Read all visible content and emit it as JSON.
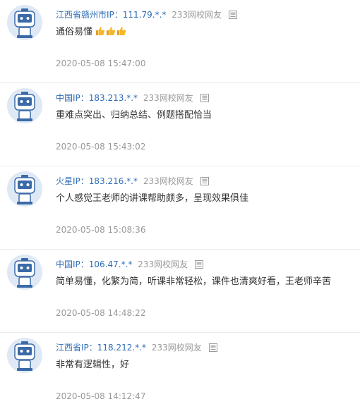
{
  "comments": [
    {
      "location": "江西省赣州市",
      "ip": "IP：111.79.*.*",
      "role": "233网校网友",
      "content": "通俗易懂",
      "emoji": [
        "thumbs-up",
        "thumbs-up",
        "thumbs-up"
      ],
      "time": "2020-05-08 15:47:00"
    },
    {
      "location": "中国",
      "ip": "IP：183.213.*.*",
      "role": "233网校网友",
      "content": "重难点突出、归纳总结、例题搭配恰当",
      "emoji": [],
      "time": "2020-05-08 15:43:02"
    },
    {
      "location": "火星",
      "ip": "IP：183.216.*.*",
      "role": "233网校网友",
      "content": "个人感觉王老师的讲课帮助颇多，呈现效果俱佳",
      "emoji": [],
      "time": "2020-05-08 15:08:36"
    },
    {
      "location": "中国",
      "ip": "IP：106.47.*.*",
      "role": "233网校网友",
      "content": "简单易懂，化繁为简，听课非常轻松，课件也清爽好看，王老师辛苦",
      "emoji": [],
      "time": "2020-05-08 14:48:22"
    },
    {
      "location": "江西省",
      "ip": "IP：118.212.*.*",
      "role": "233网校网友",
      "content": "非常有逻辑性，好",
      "emoji": [],
      "time": "2020-05-08 14:12:47"
    }
  ]
}
